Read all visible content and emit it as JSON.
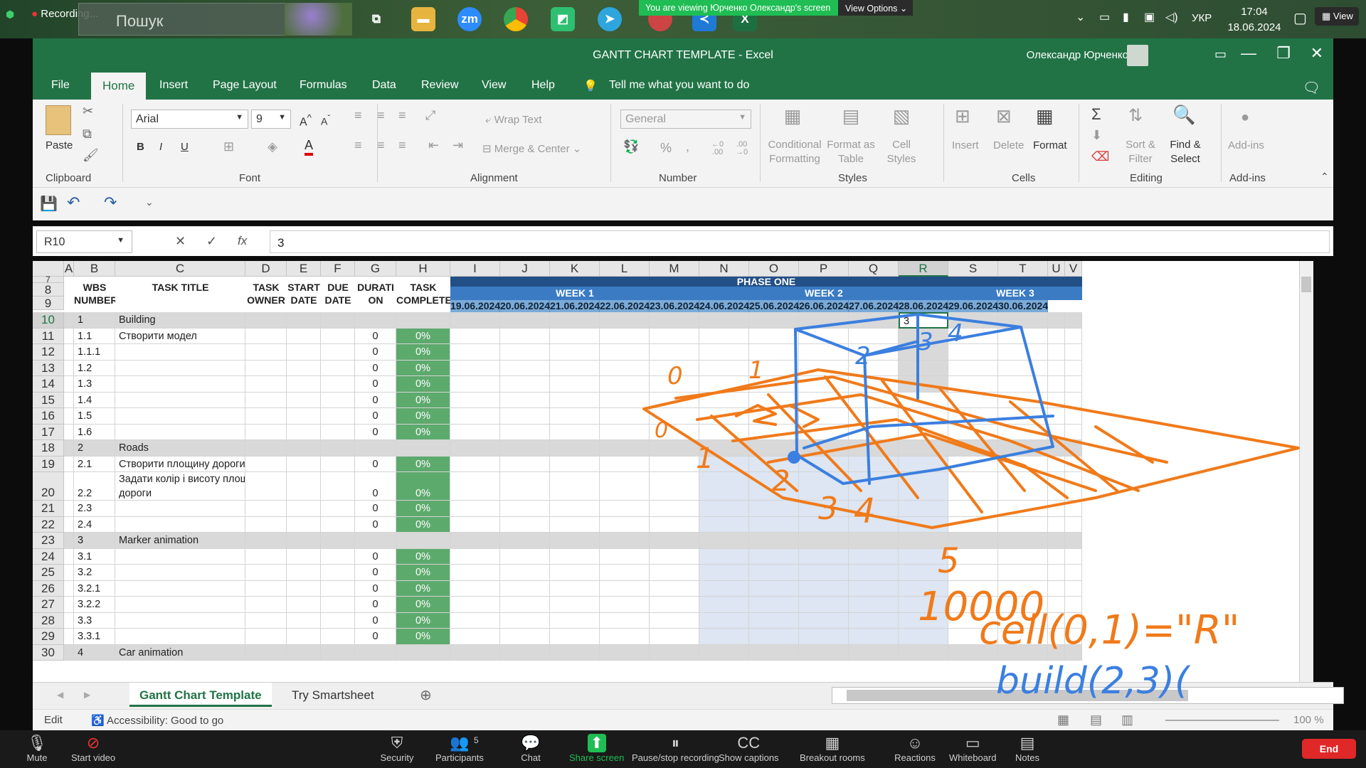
{
  "taskbar": {
    "recording_label": "Recording...",
    "search_placeholder": "Пошук",
    "share_banner": "You are viewing Юрченко Олександр's screen",
    "view_options": "View Options",
    "language": "УКР",
    "time": "17:04",
    "date": "18.06.2024",
    "view_button": "View",
    "apps": [
      "task-view-icon",
      "file-explorer-icon",
      "zoom-app-icon",
      "chrome-icon",
      "app-icon",
      "telegram-icon",
      "chrome-profile-icon",
      "vscode-icon",
      "excel-icon"
    ],
    "zoom_app_label": "zm"
  },
  "excel": {
    "window_title": "GANTT CHART TEMPLATE  -  Excel",
    "user_name": "Олександр Юрченко",
    "ribbon_tabs": [
      "File",
      "Home",
      "Insert",
      "Page Layout",
      "Formulas",
      "Data",
      "Review",
      "View",
      "Help"
    ],
    "tell_me": "Tell me what you want to do",
    "clipboard": {
      "paste": "Paste",
      "group": "Clipboard"
    },
    "font": {
      "name": "Arial",
      "size": "9",
      "group": "Font",
      "bold": "B",
      "italic": "I",
      "underline": "U"
    },
    "alignment": {
      "wrap": "Wrap Text",
      "merge": "Merge & Center",
      "group": "Alignment"
    },
    "number": {
      "format": "General",
      "percent": "%",
      "comma": ",",
      "group": "Number",
      "inc_decimal": "←0\n.00",
      "dec_decimal": ".00\n→0"
    },
    "styles": {
      "conditional": "Conditional\nFormatting",
      "format_table": "Format as\nTable",
      "cell_styles": "Cell\nStyles",
      "group": "Styles"
    },
    "cells": {
      "insert": "Insert",
      "delete": "Delete",
      "format": "Format",
      "group": "Cells"
    },
    "editing": {
      "sort": "Sort &\nFilter",
      "find": "Find &\nSelect",
      "group": "Editing"
    },
    "addins": {
      "label": "Add-ins",
      "group": "Add-ins"
    },
    "name_box": "R10",
    "formula_value": "3",
    "fx": "fx",
    "columns": [
      "A",
      "B",
      "C",
      "D",
      "E",
      "F",
      "G",
      "H",
      "I",
      "J",
      "K",
      "L",
      "M",
      "N",
      "O",
      "P",
      "Q",
      "R",
      "S",
      "T",
      "U",
      "V"
    ],
    "header": {
      "phase": "PHASE ONE",
      "week1": "WEEK 1",
      "week2": "WEEK 2",
      "week3": "WEEK 3",
      "wbs": "WBS\nNUMBER",
      "task_title": "TASK TITLE",
      "owner": "TASK\nOWNER",
      "start": "START\nDATE",
      "due": "DUE\nDATE",
      "duration": "DURATI\nON",
      "complete": "TASK\nCOMPLETE",
      "dates": [
        "19.06.2024",
        "20.06.2024",
        "21.06.2024",
        "22.06.2024",
        "23.06.2024",
        "24.06.2024",
        "25.06.2024",
        "26.06.2024",
        "27.06.2024",
        "28.06.2024",
        "29.06.2024",
        "30.06.2024"
      ]
    },
    "rows": [
      {
        "num": "10",
        "wbs": "1",
        "title": "Building",
        "dur": "",
        "pct": "",
        "type": "group",
        "r": "3"
      },
      {
        "num": "11",
        "wbs": "1.1",
        "title": "Створити модел",
        "dur": "0",
        "pct": "0%",
        "type": "task"
      },
      {
        "num": "12",
        "wbs": "1.1.1",
        "title": "",
        "dur": "0",
        "pct": "0%",
        "type": "task"
      },
      {
        "num": "13",
        "wbs": "1.2",
        "title": "",
        "dur": "0",
        "pct": "0%",
        "type": "task"
      },
      {
        "num": "14",
        "wbs": "1.3",
        "title": "",
        "dur": "0",
        "pct": "0%",
        "type": "task"
      },
      {
        "num": "15",
        "wbs": "1.4",
        "title": "",
        "dur": "0",
        "pct": "0%",
        "type": "task"
      },
      {
        "num": "16",
        "wbs": "1.5",
        "title": "",
        "dur": "0",
        "pct": "0%",
        "type": "task"
      },
      {
        "num": "17",
        "wbs": "1.6",
        "title": "",
        "dur": "0",
        "pct": "0%",
        "type": "task"
      },
      {
        "num": "18",
        "wbs": "2",
        "title": "Roads",
        "dur": "",
        "pct": "",
        "type": "group"
      },
      {
        "num": "19",
        "wbs": "2.1",
        "title": "Створити площину дороги",
        "dur": "0",
        "pct": "0%",
        "type": "task"
      },
      {
        "num": "20",
        "wbs": "2.2",
        "title": "Задати колір і висоту площини\nдороги",
        "dur": "0",
        "pct": "0%",
        "type": "task",
        "tall": true
      },
      {
        "num": "21",
        "wbs": "2.3",
        "title": "",
        "dur": "0",
        "pct": "0%",
        "type": "task"
      },
      {
        "num": "22",
        "wbs": "2.4",
        "title": "",
        "dur": "0",
        "pct": "0%",
        "type": "task"
      },
      {
        "num": "23",
        "wbs": "3",
        "title": "Marker animation",
        "dur": "",
        "pct": "",
        "type": "group"
      },
      {
        "num": "24",
        "wbs": "3.1",
        "title": "",
        "dur": "0",
        "pct": "0%",
        "type": "task"
      },
      {
        "num": "25",
        "wbs": "3.2",
        "title": "",
        "dur": "0",
        "pct": "0%",
        "type": "task"
      },
      {
        "num": "26",
        "wbs": "3.2.1",
        "title": "",
        "dur": "0",
        "pct": "0%",
        "type": "task"
      },
      {
        "num": "27",
        "wbs": "3.2.2",
        "title": "",
        "dur": "0",
        "pct": "0%",
        "type": "task"
      },
      {
        "num": "28",
        "wbs": "3.3",
        "title": "",
        "dur": "0",
        "pct": "0%",
        "type": "task"
      },
      {
        "num": "29",
        "wbs": "3.3.1",
        "title": "",
        "dur": "0",
        "pct": "0%",
        "type": "task"
      },
      {
        "num": "30",
        "wbs": "4",
        "title": "Car animation",
        "dur": "",
        "pct": "",
        "type": "group"
      }
    ],
    "sheet_tabs": [
      "Gantt Chart Template",
      "Try Smartsheet"
    ],
    "status_mode": "Edit",
    "accessibility": "Accessibility: Good to go",
    "zoom_level": "100 %"
  },
  "zoom_toolbar": [
    {
      "label": "Mute",
      "icon": "microphone-icon"
    },
    {
      "label": "Start video",
      "icon": "video-off-icon"
    },
    {
      "label": "Security",
      "icon": "shield-icon"
    },
    {
      "label": "Participants",
      "icon": "participants-icon",
      "count": "5"
    },
    {
      "label": "Chat",
      "icon": "chat-icon"
    },
    {
      "label": "Share screen",
      "icon": "share-screen-icon"
    },
    {
      "label": "Pause/stop recording",
      "icon": "pause-icon"
    },
    {
      "label": "Show captions",
      "icon": "captions-icon"
    },
    {
      "label": "Breakout rooms",
      "icon": "breakout-icon"
    },
    {
      "label": "Reactions",
      "icon": "reactions-icon"
    },
    {
      "label": "Whiteboard",
      "icon": "whiteboard-icon"
    },
    {
      "label": "Notes",
      "icon": "notes-icon"
    }
  ],
  "end_button": "End",
  "annotations": {
    "orange_texts": [
      "0",
      "1",
      "0",
      "1",
      "2",
      "3",
      "4",
      "5",
      "10000",
      "cell(0,1)=\"R\""
    ],
    "blue_texts": [
      "2",
      "3",
      "4",
      "build(2,3)("
    ],
    "colors": {
      "orange": "#f07a1a",
      "blue": "#3b7fe0",
      "excel_green": "#217346"
    }
  }
}
